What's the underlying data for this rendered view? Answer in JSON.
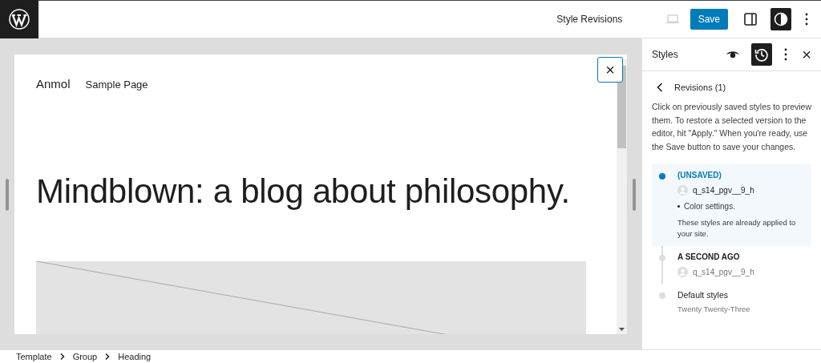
{
  "top_bar": {
    "title": "Style Revisions",
    "save_label": "Save",
    "device_preview": {
      "disabled": true
    },
    "settings_toggle": {
      "pressed": false
    },
    "styles_toggle": {
      "pressed": true
    }
  },
  "canvas": {
    "nav": [
      "Anmol",
      "Sample Page"
    ],
    "heading": "Mindblown: a blog about philosophy.",
    "close_label": "×"
  },
  "sidebar": {
    "title": "Styles",
    "style_book": {
      "pressed": false
    },
    "revisions_toggle": {
      "pressed": true
    },
    "close_label": "×",
    "back_title": "Revisions (1)",
    "description": "Click on previously saved styles to preview them. To restore a selected version to the editor, hit \"Apply.\" When you're ready, use the Save button to save your changes.",
    "revisions": [
      {
        "kind": "revision",
        "title": "(UNSAVED)",
        "author": "q_s14_pgv__9_h",
        "changes": [
          "Color settings."
        ],
        "note": "These styles are already applied to your site.",
        "selected": true
      },
      {
        "kind": "revision",
        "title": "A SECOND AGO",
        "author": "q_s14_pgv__9_h",
        "selected": false
      },
      {
        "kind": "default",
        "title": "Default styles",
        "subtitle": "Twenty Twenty-Three",
        "selected": false
      }
    ]
  },
  "breadcrumbs": [
    "Template",
    "Group",
    "Heading"
  ]
}
